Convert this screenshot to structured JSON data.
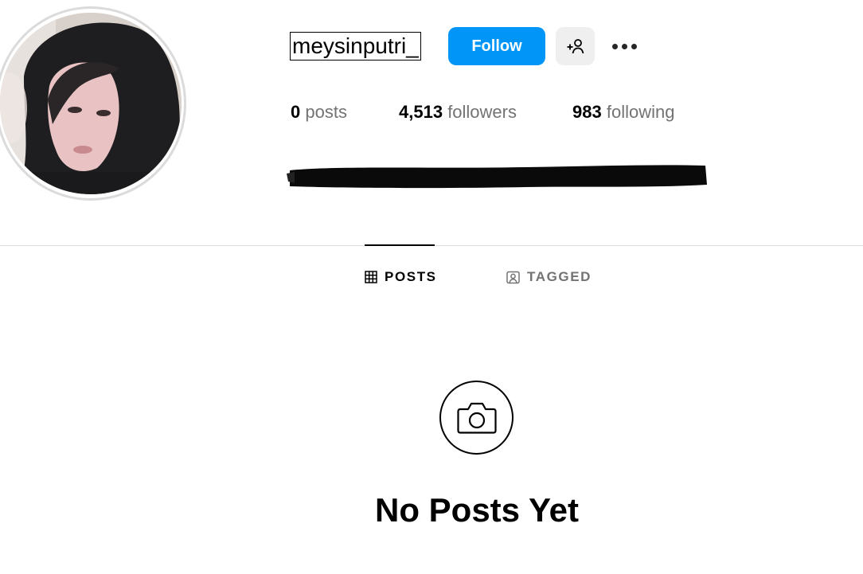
{
  "profile": {
    "username": "meysinputri_",
    "follow_label": "Follow",
    "suggest_icon": "add-person-icon",
    "more_icon": "more-horizontal-icon",
    "avatar": "profile-photo"
  },
  "stats": {
    "posts_count": "0",
    "posts_label": "posts",
    "followers_count": "4,513",
    "followers_label": "followers",
    "following_count": "983",
    "following_label": "following"
  },
  "bio": {
    "redacted": true
  },
  "tabs": [
    {
      "label": "POSTS",
      "icon": "grid-icon",
      "active": true
    },
    {
      "label": "TAGGED",
      "icon": "tagged-icon",
      "active": false
    }
  ],
  "empty_state": {
    "icon": "camera-icon",
    "title": "No Posts Yet"
  },
  "colors": {
    "follow_button": "#0095f6",
    "secondary_button": "#efefef",
    "muted_text": "#737373",
    "divider": "#dbdbdb"
  }
}
